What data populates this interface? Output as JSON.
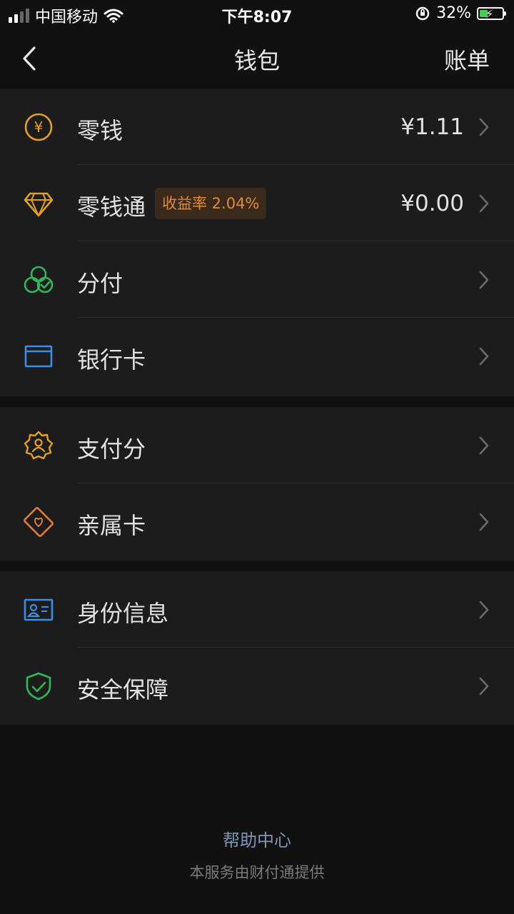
{
  "status_bar": {
    "carrier": "中国移动",
    "time": "下午8:07",
    "battery_percent": "32%",
    "signal_bars_on": 2,
    "signal_bars_total": 4,
    "icons": [
      "wifi-icon",
      "orientation-lock-icon",
      "battery-charging-icon"
    ]
  },
  "nav": {
    "title": "钱包",
    "right_action": "账单",
    "back_icon": "chevron-left-icon"
  },
  "sections": [
    {
      "items": [
        {
          "label": "零钱",
          "value": "¥1.11",
          "icon": "yuan-coin-icon",
          "icon_color": "#e3a21a"
        },
        {
          "label": "零钱通",
          "badge": "收益率 2.04%",
          "value": "¥0.00",
          "icon": "diamond-icon",
          "icon_color": "#e3a21a"
        },
        {
          "label": "分付",
          "icon": "overlapping-circles-icon",
          "icon_color": "#2fb858"
        },
        {
          "label": "银行卡",
          "icon": "card-icon",
          "icon_color": "#3a8ee6"
        }
      ]
    },
    {
      "items": [
        {
          "label": "支付分",
          "icon": "badge-person-icon",
          "icon_color": "#e3a21a"
        },
        {
          "label": "亲属卡",
          "icon": "heart-card-icon",
          "icon_color": "#e07a2f"
        }
      ]
    },
    {
      "items": [
        {
          "label": "身份信息",
          "icon": "id-card-icon",
          "icon_color": "#3a8ee6"
        },
        {
          "label": "安全保障",
          "icon": "shield-check-icon",
          "icon_color": "#2fb858"
        }
      ]
    }
  ],
  "footer": {
    "help_link": "帮助中心",
    "provider_note": "本服务由财付通提供"
  },
  "colors": {
    "background": "#111111",
    "section_bg": "#1c1c1c",
    "badge_bg": "#3a2a1b",
    "badge_text": "#e08a36",
    "link": "#7f96b8"
  }
}
